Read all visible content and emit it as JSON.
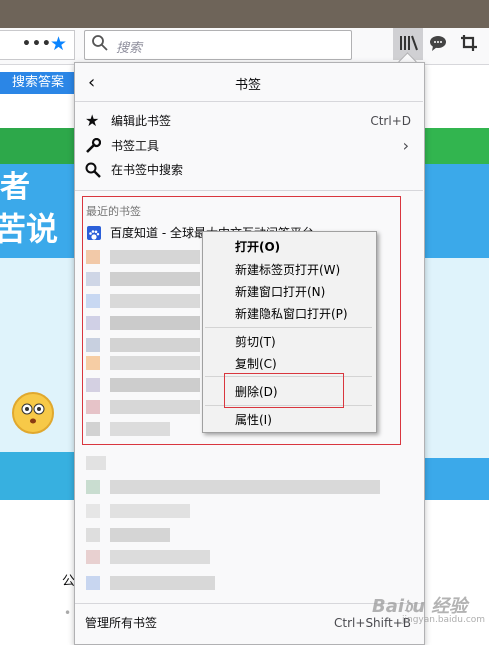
{
  "toolbar": {
    "search_placeholder": "搜索",
    "dots": "•••"
  },
  "page": {
    "search_answer_button": "搜索答案",
    "hero_line1": "者",
    "hero_line2": "苦说",
    "gong_text": "公"
  },
  "panel": {
    "title": "书签",
    "back_glyph": "‹",
    "items": [
      {
        "label": "编辑此书签",
        "shortcut": "Ctrl+D"
      },
      {
        "label": "书签工具",
        "shortcut": "›"
      },
      {
        "label": "在书签中搜索",
        "shortcut": ""
      }
    ],
    "recent_label": "最近的书签",
    "first_recent": "百度知道 - 全球最大中文互动问答平台",
    "manage_all": "管理所有书签",
    "manage_shortcut": "Ctrl+Shift+B"
  },
  "context_menu": {
    "items": [
      {
        "label": "打开(O)",
        "bold": true
      },
      {
        "label": "新建标签页打开(W)"
      },
      {
        "label": "新建窗口打开(N)"
      },
      {
        "label": "新建隐私窗口打开(P)"
      },
      {
        "label": "剪切(T)"
      },
      {
        "label": "复制(C)"
      },
      {
        "label": "删除(D)"
      },
      {
        "label": "属性(I)"
      }
    ]
  },
  "watermark": {
    "text": "Bai𝔡u 经验",
    "sub": "jingyan.baidu.com"
  },
  "colors": {
    "accent": "#0a84ff",
    "highlight_red": "#d9363e",
    "green_bar": "#2da84a",
    "page_blue": "#2b86e6"
  },
  "icons": [
    "search-icon",
    "star-icon",
    "library-icon",
    "chat-icon",
    "crop-icon",
    "wrench-icon",
    "paw-icon",
    "back-icon"
  ]
}
